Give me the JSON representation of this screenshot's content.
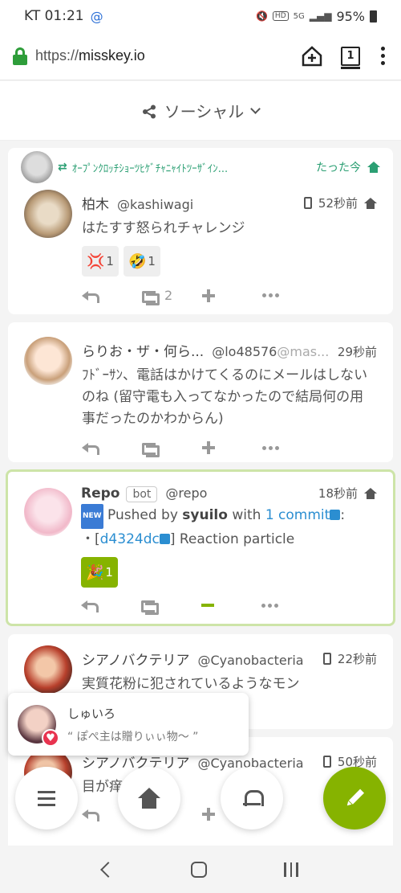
{
  "statusbar": {
    "carrier_time": "KT 01:21",
    "battery": "95%"
  },
  "browser": {
    "url_scheme": "https://",
    "url_host": "misskey.io",
    "tab_count": "1"
  },
  "header": {
    "title": "ソーシャル"
  },
  "notes": [
    {
      "renote_by": "ｵｰﾌﾟﾝｸﾛｯﾁｼｮｰﾂﾋｹﾞﾁｬﾆｬｲﾄﾂｰｻﾞｲﾝ...",
      "renote_time": "たった今",
      "name": "柏木",
      "username": "@kashiwagi",
      "host": "",
      "time": "52秒前",
      "text": "はたすす怒られチャレンジ",
      "reactions": [
        {
          "emoji": "💢",
          "count": "1"
        },
        {
          "emoji": "🤣",
          "count": "1"
        }
      ],
      "renote_count": "2"
    },
    {
      "name": "らりお・ザ・何ら...",
      "username": "@lo48576",
      "host": "@mas...",
      "time": "29秒前",
      "text": "ﾌﾄﾞｰｻﾝ、電話はかけてくるのにメールはしないのね (留守電も入ってなかったので結局何の用事だったのかわからん)"
    },
    {
      "name": "Repo",
      "bot_label": "bot",
      "username": "@repo",
      "time": "18秒前",
      "new_label": "NEW",
      "line1_pushed": "Pushed by",
      "line1_user": "syuilo",
      "line1_with": "with",
      "line1_commit": "1 commit",
      "line2_bullet": "・[",
      "line2_hash": "d4324dc",
      "line2_rest": "] Reaction particle",
      "reactions": [
        {
          "emoji": "🎉",
          "count": "1"
        }
      ]
    },
    {
      "name": "シアノバクテリア",
      "username": "@Cyanobacteria",
      "time": "22秒前",
      "text": "実質花粉に犯されているようなモン"
    },
    {
      "name": "シアノバクテリア",
      "username": "@Cyanobacteria",
      "time": "50秒前",
      "text": "目が痒"
    }
  ],
  "popup": {
    "name": "しゅいろ",
    "quote": "“ ぽぺ主は贈りぃぃ物〜 ”"
  },
  "colors": {
    "accent": "#86b300",
    "renote": "#2b9f73",
    "link": "#2b8ed1"
  }
}
